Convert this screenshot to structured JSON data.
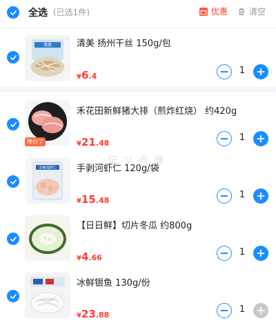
{
  "header": {
    "select_all_label": "全选",
    "selected_count": "(已选1件)",
    "promo_label": "优惠",
    "clear_label": "清空"
  },
  "items": [
    {
      "title": "清美 扬州干丝 150g/包",
      "price_symbol": "¥",
      "price_int": "6",
      "price_dec": ".4",
      "quantity": "1",
      "checked": true,
      "tag": ""
    },
    {
      "title": "禾花田新鲜猪大排（煎炸红烧） 约420g",
      "price_symbol": "¥",
      "price_int": "21",
      "price_dec": ".48",
      "quantity": "1",
      "checked": true,
      "tag": "降价了"
    },
    {
      "title": "手剥河虾仁 120g/袋",
      "price_symbol": "¥",
      "price_int": "15",
      "price_dec": ".48",
      "quantity": "1",
      "checked": true,
      "tag": ""
    },
    {
      "title": "【日日鲜】切片冬瓜 约800g",
      "price_symbol": "¥",
      "price_int": "4",
      "price_dec": ".66",
      "quantity": "1",
      "checked": true,
      "tag": ""
    },
    {
      "title": "冰鲜银鱼 130g/份",
      "price_symbol": "¥",
      "price_int": "23",
      "price_dec": ".88",
      "quantity": "1",
      "checked": true,
      "tag": "",
      "plus_disabled": true
    }
  ],
  "thumb_labels": {
    "item0": "清美",
    "item2": "手剥河虾仁"
  },
  "watermark": "记 ツ 点 展",
  "colors": {
    "accent": "#1a8cff",
    "price": "#ff3b30",
    "promo": "#ff5a3c",
    "disabled": "#c8c8c8"
  }
}
